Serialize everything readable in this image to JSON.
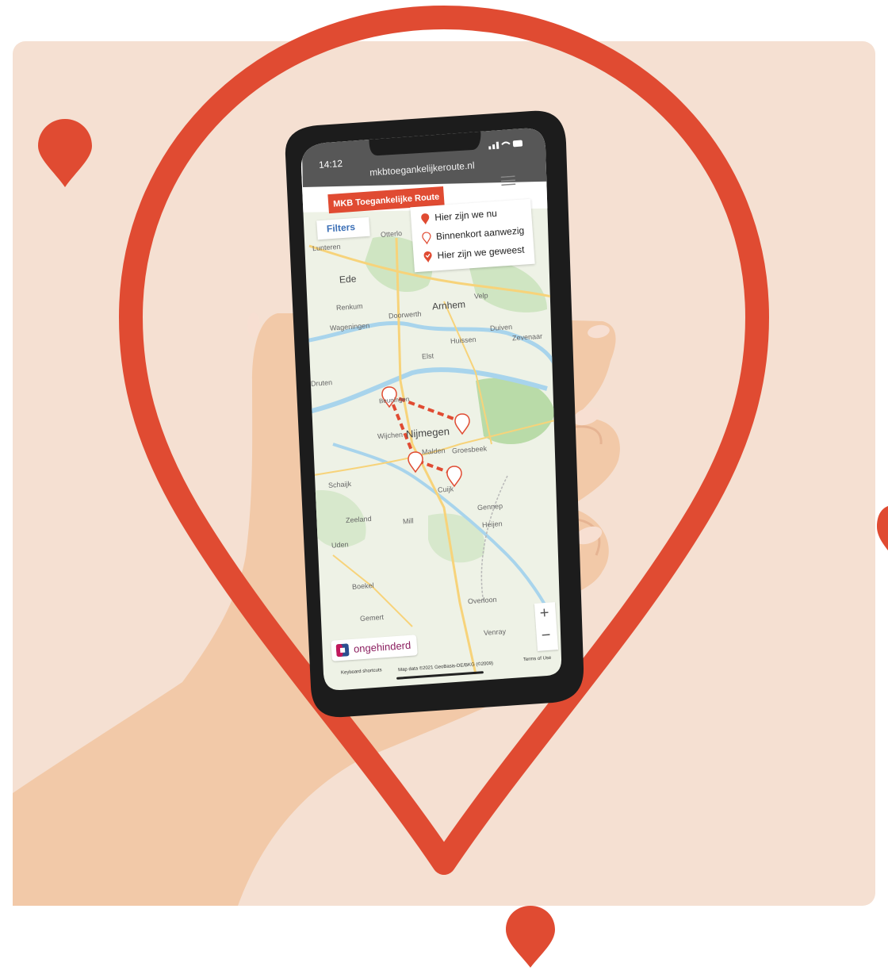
{
  "status_bar": {
    "time": "14:12"
  },
  "browser": {
    "url": "mkbtoegankelijkeroute.nl"
  },
  "site": {
    "brand_label": "MKB Toegankelijke Route",
    "filters_label": "Filters",
    "legend": [
      {
        "icon": "pin-filled-icon",
        "label": "Hier zijn we nu"
      },
      {
        "icon": "pin-outline-icon",
        "label": "Binnenkort aanwezig"
      },
      {
        "icon": "pin-check-icon",
        "label": "Hier zijn we geweest"
      }
    ]
  },
  "map": {
    "places": [
      "Otterlo",
      "Lunteren",
      "Ede",
      "Arnhem",
      "Velp",
      "Renkum",
      "Doorwerth",
      "Wageningen",
      "Duiven",
      "Zevenaar",
      "Huissen",
      "Elst",
      "Druten",
      "Nijmegen",
      "Wijchen",
      "Malden",
      "Groesbeek",
      "Cuijk",
      "Schaijk",
      "Zeeland",
      "Mill",
      "Gennep",
      "Heijen",
      "Uden",
      "Boekel",
      "Gemert",
      "Overloon",
      "Venray",
      "Beuningen"
    ],
    "zoom_in_label": "+",
    "zoom_out_label": "−",
    "footer_shortcuts": "Keyboard shortcuts",
    "footer_mapdata": "Map data ©2021 GeoBasis-DE/BKG (©2009)",
    "footer_terms": "Terms of Use"
  },
  "logo": {
    "name": "ongehinderd"
  },
  "colors": {
    "accent": "#e04b32",
    "background_panel": "#f5e0d2",
    "phone_body": "#1c1c1c"
  }
}
